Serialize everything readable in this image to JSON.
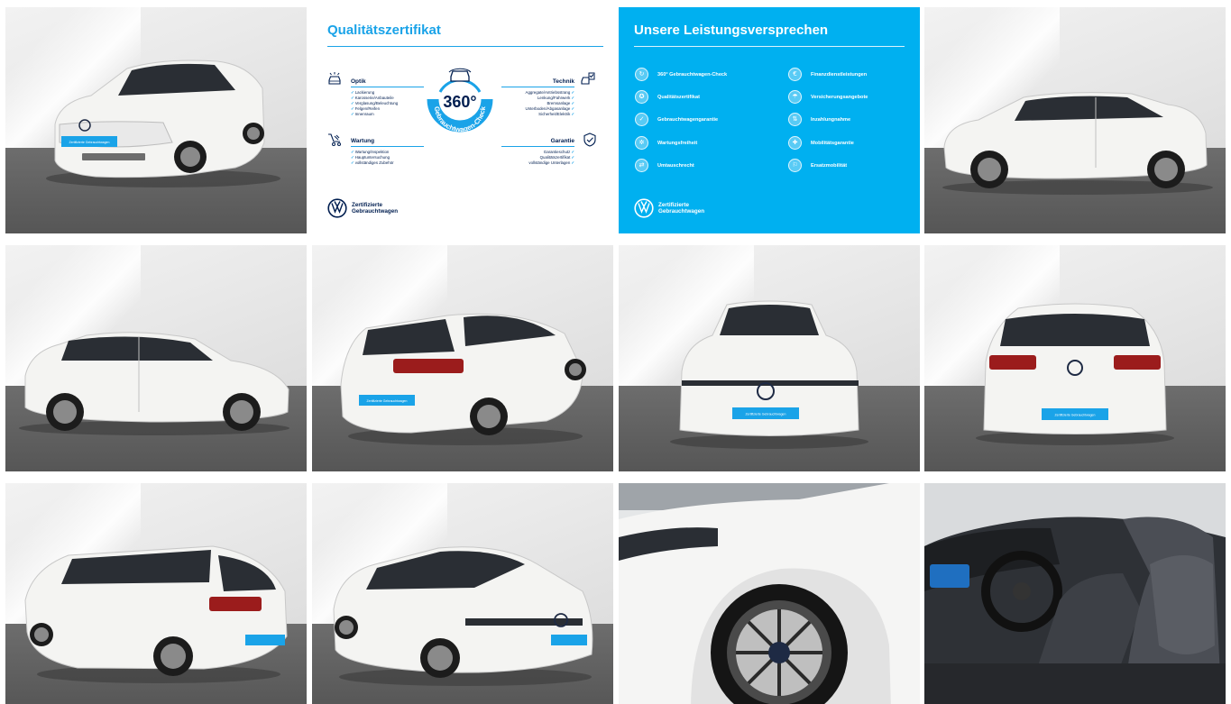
{
  "colors": {
    "vw_blue": "#001e50",
    "accent_blue": "#1aa3e8",
    "promise_bg": "#00b0f0",
    "car_white": "#f4f4f2"
  },
  "license_plate_text": "Zertifizierte Gebrauchtwagen",
  "qualitaet": {
    "title": "Qualitätszertifikat",
    "badge_number": "360°",
    "badge_ring_text": "Gebrauchtwagen-Check",
    "optik": {
      "heading": "Optik",
      "icon": "car-inspection-icon",
      "items": [
        "Lackierung",
        "Karosserie/Anbauteile",
        "Verglasung/Beleuchtung",
        "Felgen/Reifen",
        "Innenraum"
      ]
    },
    "wartung": {
      "heading": "Wartung",
      "icon": "service-cart-icon",
      "items": [
        "Wartung/Inspektion",
        "Hauptuntersuchung",
        "vollständiges Zubehör"
      ]
    },
    "technik": {
      "heading": "Technik",
      "icon": "car-checklist-icon",
      "items": [
        "Aggregate/Antriebsstrang",
        "Lenkung/Fahrwerk",
        "Bremsanlage",
        "Unterboden/Abgasanlage",
        "Sicherheit/Elektrik"
      ]
    },
    "garantie": {
      "heading": "Garantie",
      "icon": "shield-check-icon",
      "items": [
        "Garantieschutz",
        "Qualitätszertifikat",
        "vollständige Unterlagen"
      ]
    },
    "logo_label": "Zertifizierte\nGebrauchtwagen"
  },
  "leistung": {
    "title": "Unsere Leistungsversprechen",
    "left_items": [
      {
        "label": "360° Gebrauchtwagen-Check",
        "icon": "car-360-icon",
        "glyph": "↻"
      },
      {
        "label": "Qualitätszertifikat",
        "icon": "certificate-icon",
        "glyph": "✪"
      },
      {
        "label": "Gebrauchtwagengarantie",
        "icon": "shield-check-icon",
        "glyph": "✓"
      },
      {
        "label": "Wartungsfreiheit",
        "icon": "wrench-icon",
        "glyph": "✲"
      },
      {
        "label": "Umtauschrecht",
        "icon": "exchange-icon",
        "glyph": "⇄"
      }
    ],
    "right_items": [
      {
        "label": "Finanzdienstleistungen",
        "icon": "finance-icon",
        "glyph": "€"
      },
      {
        "label": "Versicherungsangebote",
        "icon": "insurance-icon",
        "glyph": "☂"
      },
      {
        "label": "Inzahlungnahme",
        "icon": "trade-in-icon",
        "glyph": "⇅"
      },
      {
        "label": "Mobilitätsgarantie",
        "icon": "mobility-icon",
        "glyph": "✚"
      },
      {
        "label": "Ersatzmobilität",
        "icon": "replacement-car-icon",
        "glyph": "⚐"
      }
    ],
    "logo_label": "Zertifizierte\nGebrauchtwagen"
  }
}
